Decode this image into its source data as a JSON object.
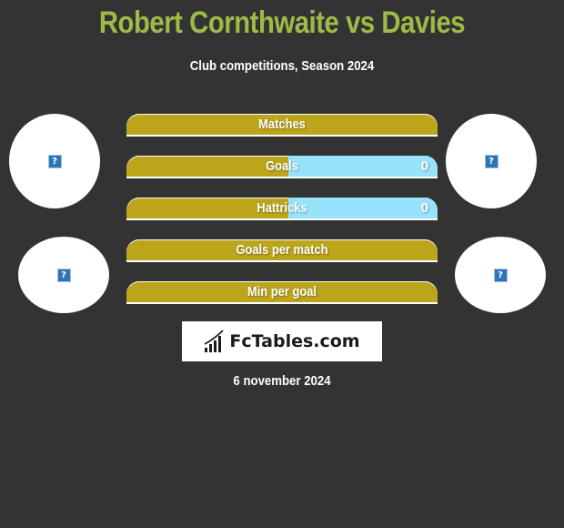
{
  "header": {
    "title": "Robert Cornthwaite vs Davies",
    "subtitle": "Club competitions, Season 2024"
  },
  "players": {
    "left": {
      "name": "Robert Cornthwaite",
      "avatar_icon": "missing-image-icon"
    },
    "right": {
      "name": "Davies",
      "avatar_icon": "missing-image-icon"
    }
  },
  "colors": {
    "title": "#9cbc46",
    "left_bar": "#bca41b",
    "right_bar": "#97e3fc",
    "background": "#333333"
  },
  "chart_data": {
    "type": "bar",
    "title": "Robert Cornthwaite vs Davies",
    "subtitle": "Club competitions, Season 2024",
    "categories": [
      "Matches",
      "Goals",
      "Hattricks",
      "Goals per match",
      "Min per goal"
    ],
    "series": [
      {
        "name": "Robert Cornthwaite",
        "values": [
          null,
          null,
          null,
          null,
          null
        ]
      },
      {
        "name": "Davies",
        "values": [
          null,
          0,
          0,
          null,
          null
        ]
      }
    ],
    "right_share": [
      0,
      0.48,
      0.48,
      0,
      0
    ],
    "right_labels": [
      "",
      "0",
      "0",
      "",
      ""
    ]
  },
  "footer": {
    "logo_text": "FcTables.com",
    "date": "6 november 2024"
  }
}
